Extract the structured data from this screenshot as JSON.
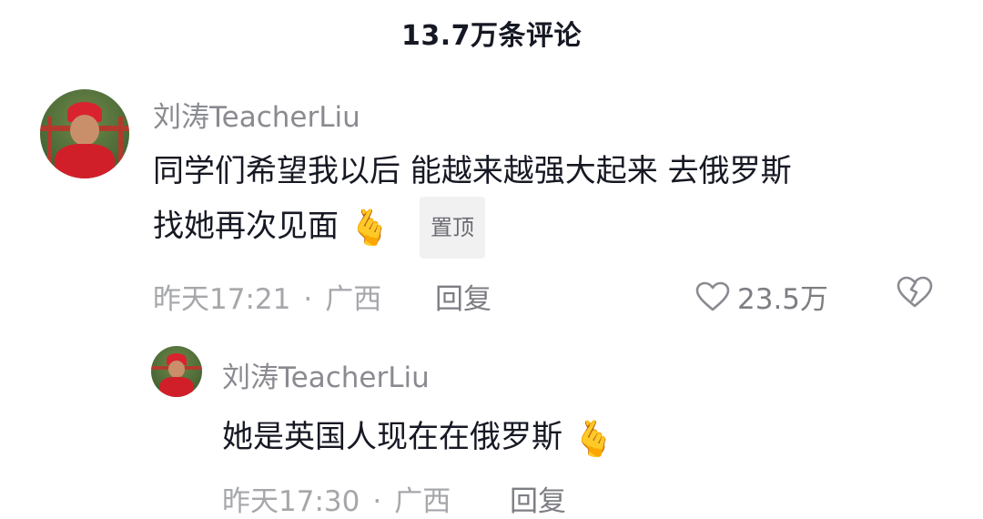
{
  "header": {
    "title": "13.7万条评论"
  },
  "comment": {
    "username": "刘涛TeacherLiu",
    "line1": "同学们希望我以后 能越来越强大起来 去俄罗斯",
    "line2": "找她再次见面",
    "emoji": "🫰",
    "pin_label": "置顶",
    "time": "昨天17:21",
    "dot": "·",
    "location": "广西",
    "reply_label": "回复",
    "like_count": "23.5万"
  },
  "reply": {
    "username": "刘涛TeacherLiu",
    "text": "她是英国人现在在俄罗斯",
    "emoji": "🫰",
    "time": "昨天17:30",
    "dot": "·",
    "location": "广西",
    "reply_label": "回复"
  },
  "colors": {
    "text_primary": "#161823",
    "text_secondary": "#8a8b91",
    "text_meta": "#a6a7ab"
  },
  "icons": {
    "like": "heart-outline-icon",
    "dislike": "broken-heart-icon"
  }
}
